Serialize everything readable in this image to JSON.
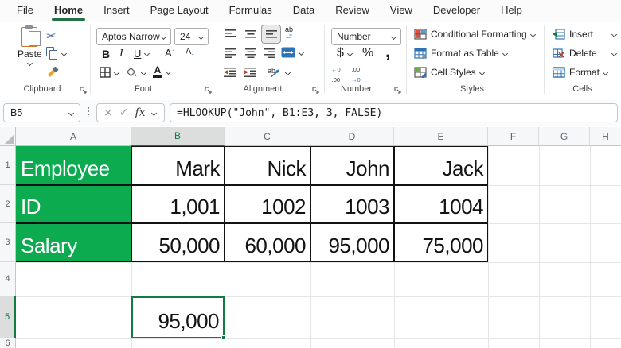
{
  "menu": {
    "items": [
      "File",
      "Home",
      "Insert",
      "Page Layout",
      "Formulas",
      "Data",
      "Review",
      "View",
      "Developer",
      "Help"
    ],
    "active_item": "Home"
  },
  "ribbon": {
    "clipboard": {
      "group_label": "Clipboard",
      "paste_label": "Paste"
    },
    "font": {
      "group_label": "Font",
      "family": "Aptos Narrow",
      "size": "24",
      "bold": "B",
      "italic": "I",
      "underline": "U",
      "grow_font": "A",
      "shrink_font": "A",
      "font_color": "A"
    },
    "alignment": {
      "group_label": "Alignment"
    },
    "number": {
      "group_label": "Number",
      "format": "Number",
      "currency": "$",
      "percent": "%",
      "comma": ","
    },
    "styles": {
      "group_label": "Styles",
      "conditional_formatting": "Conditional Formatting",
      "format_as_table": "Format as Table",
      "cell_styles": "Cell Styles"
    },
    "cells": {
      "group_label": "Cells",
      "insert": "Insert",
      "delete": "Delete",
      "format": "Format"
    }
  },
  "formula_bar": {
    "name_box": "B5",
    "cancel": "×",
    "enter": "✓",
    "fx": "fx",
    "formula": "=HLOOKUP(\"John\", B1:E3, 3, FALSE)"
  },
  "icons": {
    "cut": "✂",
    "wrap_ab": "ab",
    "wrap_c": "c",
    "orient_ab": "ab",
    "inc_decimal_top": "←0",
    "inc_decimal_bot": ".00",
    "dec_decimal_top": ".00",
    "dec_decimal_bot": "→0"
  },
  "sheet": {
    "col_headers": [
      "A",
      "B",
      "C",
      "D",
      "E",
      "F",
      "G",
      "H"
    ],
    "row_headers": [
      "1",
      "2",
      "3",
      "4",
      "5",
      "6"
    ],
    "selected_cell": "B5",
    "rows": [
      {
        "label": "Employee",
        "values": [
          "Mark",
          "Nick",
          "John",
          "Jack"
        ]
      },
      {
        "label": "ID",
        "values": [
          "1,001",
          "1002",
          "1003",
          "1004"
        ]
      },
      {
        "label": "Salary",
        "values": [
          "50,000",
          "60,000",
          "95,000",
          "75,000"
        ]
      }
    ],
    "result": "95,000"
  },
  "colors": {
    "fill_green": "#0CAB50",
    "accent_green": "#107C41",
    "tab_underline_green": "#217346"
  }
}
